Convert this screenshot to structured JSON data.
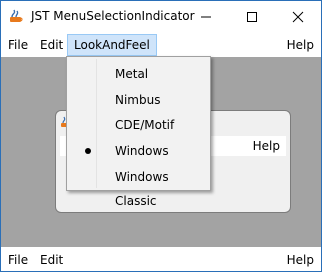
{
  "window": {
    "title": "JST MenuSelectionIndicator",
    "accent_color": "#2a6fb8",
    "controls": [
      "minimize-icon",
      "maximize-icon",
      "close-icon"
    ]
  },
  "menubar": {
    "file": "File",
    "edit": "Edit",
    "lookandfeel": "LookAndFeel",
    "help": "Help"
  },
  "dropdown": {
    "options": [
      {
        "label": "Metal",
        "selected": false
      },
      {
        "label": "Nimbus",
        "selected": false
      },
      {
        "label": "CDE/Motif",
        "selected": false
      },
      {
        "label": "Windows",
        "selected": true
      },
      {
        "label": "Windows Classic",
        "selected": false
      }
    ]
  },
  "inner_frame": {
    "help": "Help"
  },
  "bottom_menubar": {
    "file": "File",
    "edit": "Edit",
    "help": "Help"
  },
  "colors": {
    "content_bg": "#a3a3a3",
    "menu_highlight": "#cfe4fa"
  }
}
